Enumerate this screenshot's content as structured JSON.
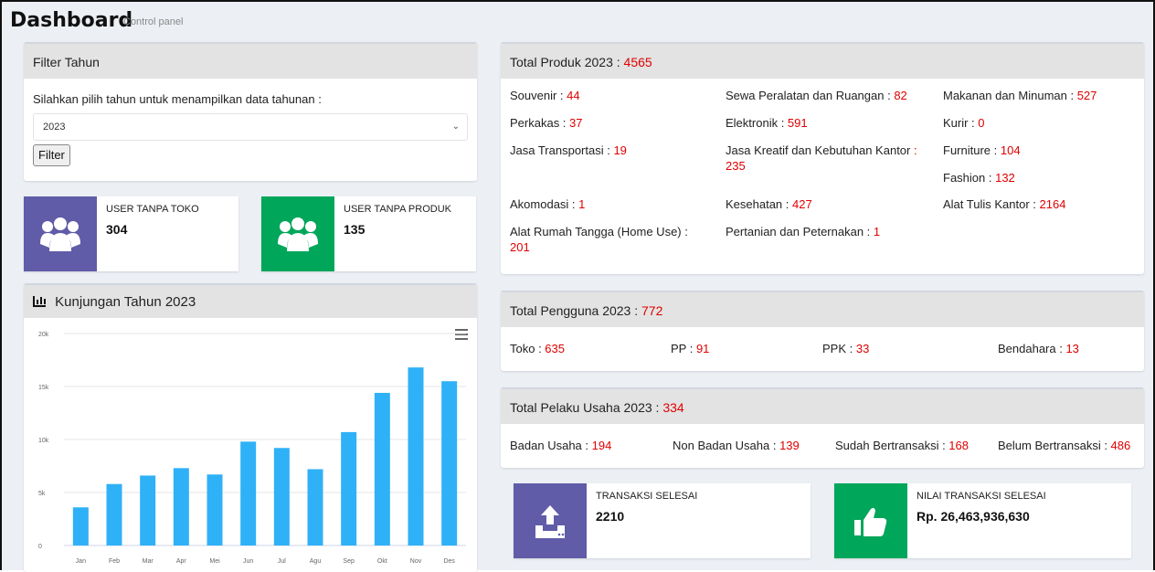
{
  "header": {
    "title": "Dashboard",
    "subtitle": "Control panel"
  },
  "filter": {
    "title": "Filter Tahun",
    "description": "Silahkan pilih tahun untuk menampilkan data tahunan :",
    "selected_year": "2023",
    "button": "Filter"
  },
  "info_boxes": {
    "user_tanpa_toko": {
      "label": "USER TANPA TOKO",
      "value": "304",
      "icon": "users-icon"
    },
    "user_tanpa_produk": {
      "label": "USER TANPA PRODUK",
      "value": "135",
      "icon": "users-icon"
    },
    "transaksi_selesai": {
      "label": "TRANSAKSI SELESAI",
      "value": "2210",
      "icon": "upload-icon"
    },
    "nilai_transaksi": {
      "label": "NILAI TRANSAKSI SELESAI",
      "value": "Rp. 26,463,936,630",
      "icon": "thumbs-up-icon"
    }
  },
  "colors": {
    "purple": "#605ca8",
    "green": "#00a65a",
    "bar": "#2fb1f7",
    "value_red": "#e00000"
  },
  "produk": {
    "title": "Total Produk 2023 :",
    "total": "4565",
    "items": [
      {
        "label": "Souvenir :",
        "value": "44"
      },
      {
        "label": "Sewa Peralatan dan Ruangan :",
        "value": "82"
      },
      {
        "label": "Makanan dan Minuman :",
        "value": "527"
      },
      {
        "label": "Perkakas :",
        "value": "37"
      },
      {
        "label": "Elektronik :",
        "value": "591"
      },
      {
        "label": "Kurir :",
        "value": "0"
      },
      {
        "label": "Jasa Transportasi :",
        "value": "19"
      },
      {
        "label": "Jasa Kreatif dan Kebutuhan Kantor",
        "value": ": 235"
      },
      {
        "label": "Furniture :",
        "value": "104"
      },
      {
        "label": "Fashion :",
        "value": "132"
      },
      {
        "label": "Akomodasi :",
        "value": "1"
      },
      {
        "label": "Kesehatan :",
        "value": "427"
      },
      {
        "label": "Alat Tulis Kantor :",
        "value": "2164"
      },
      {
        "label": "Alat Rumah Tangga (Home Use) :",
        "value": "201"
      },
      {
        "label": "Pertanian dan Peternakan :",
        "value": "1"
      }
    ]
  },
  "pengguna": {
    "title": "Total Pengguna 2023 :",
    "total": "772",
    "items": [
      {
        "label": "Toko :",
        "value": "635"
      },
      {
        "label": "PP :",
        "value": "91"
      },
      {
        "label": "PPK :",
        "value": "33"
      },
      {
        "label": "Bendahara :",
        "value": "13"
      }
    ]
  },
  "pelaku": {
    "title": "Total Pelaku Usaha 2023 :",
    "total": "334",
    "items": [
      {
        "label": "Badan Usaha :",
        "value": "194"
      },
      {
        "label": "Non Badan Usaha :",
        "value": "139"
      },
      {
        "label": "Sudah Bertransaksi :",
        "value": "168"
      },
      {
        "label": "Belum Bertransaksi :",
        "value": "486"
      }
    ]
  },
  "chart_title": "Kunjungan Tahun 2023",
  "chart_data": {
    "type": "bar",
    "categories": [
      "Jan",
      "Feb",
      "Mar",
      "Apr",
      "Mei",
      "Jun",
      "Jul",
      "Agu",
      "Sep",
      "Okt",
      "Nov",
      "Des"
    ],
    "values": [
      3600,
      5800,
      6600,
      7300,
      6700,
      9800,
      9200,
      7200,
      10700,
      14400,
      16800,
      15500
    ],
    "ylim": [
      0,
      20000
    ],
    "yticks": [
      "0",
      "5k",
      "10k",
      "15k",
      "20k"
    ],
    "grid": true
  }
}
